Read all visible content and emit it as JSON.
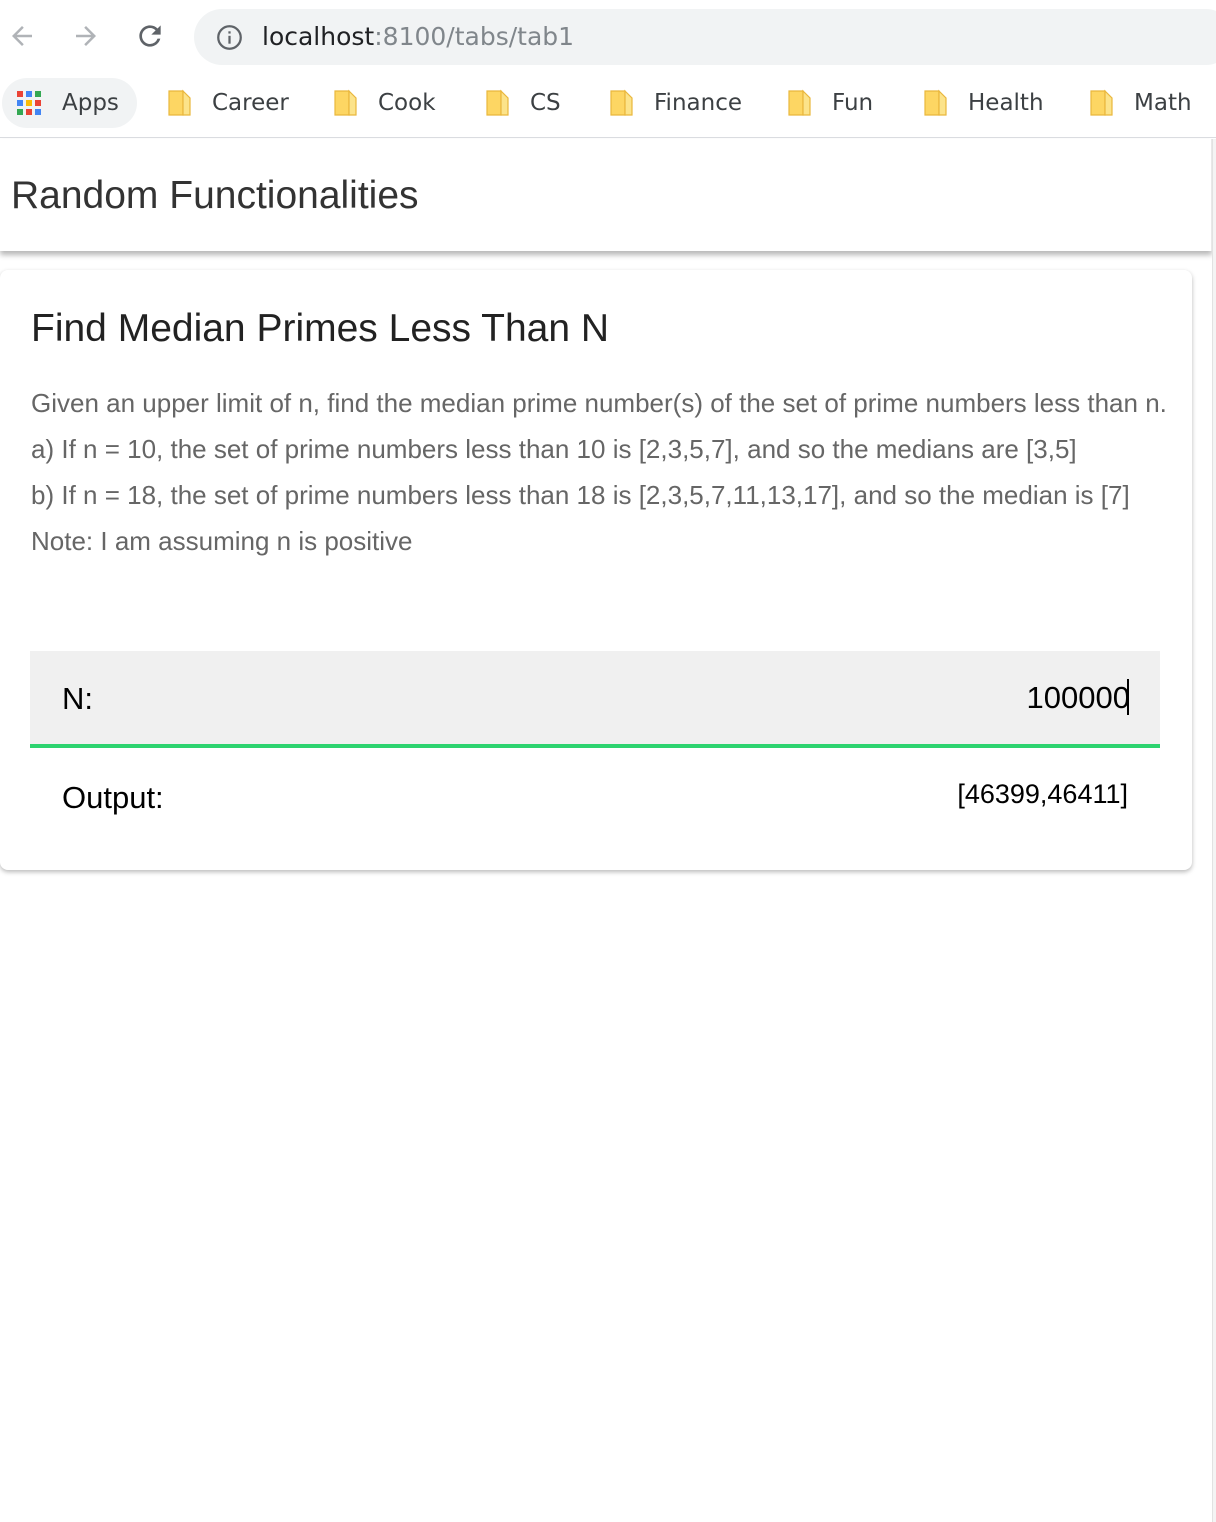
{
  "browser": {
    "url_host": "localhost",
    "url_rest": ":8100/tabs/tab1"
  },
  "bookmarks": [
    {
      "label": "Apps",
      "icon": "apps-grid-icon"
    },
    {
      "label": "Career",
      "icon": "folder-icon"
    },
    {
      "label": "Cook",
      "icon": "folder-icon"
    },
    {
      "label": "CS",
      "icon": "folder-icon"
    },
    {
      "label": "Finance",
      "icon": "folder-icon"
    },
    {
      "label": "Fun",
      "icon": "folder-icon"
    },
    {
      "label": "Health",
      "icon": "folder-icon"
    },
    {
      "label": "Math",
      "icon": "folder-icon"
    }
  ],
  "header": {
    "title": "Random Functionalities"
  },
  "card": {
    "title": "Find Median Primes Less Than N",
    "description": "Given an upper limit of n, find the median prime number(s) of the set of prime numbers less than n.",
    "example_a": "a) If n = 10, the set of prime numbers less than 10 is [2,3,5,7], and so the medians are [3,5]",
    "example_b": "b) If n = 18, the set of prime numbers less than 18 is [2,3,5,7,11,13,17], and so the median is [7]",
    "note": "Note: I am assuming n is positive",
    "n_label": "N:",
    "n_value": "100000",
    "output_label": "Output:",
    "output_value": "[46399,46411]"
  },
  "colors": {
    "input_underline": "#2dd36f",
    "folder": "#fdd663",
    "omnibox_bg": "#f1f3f4"
  }
}
